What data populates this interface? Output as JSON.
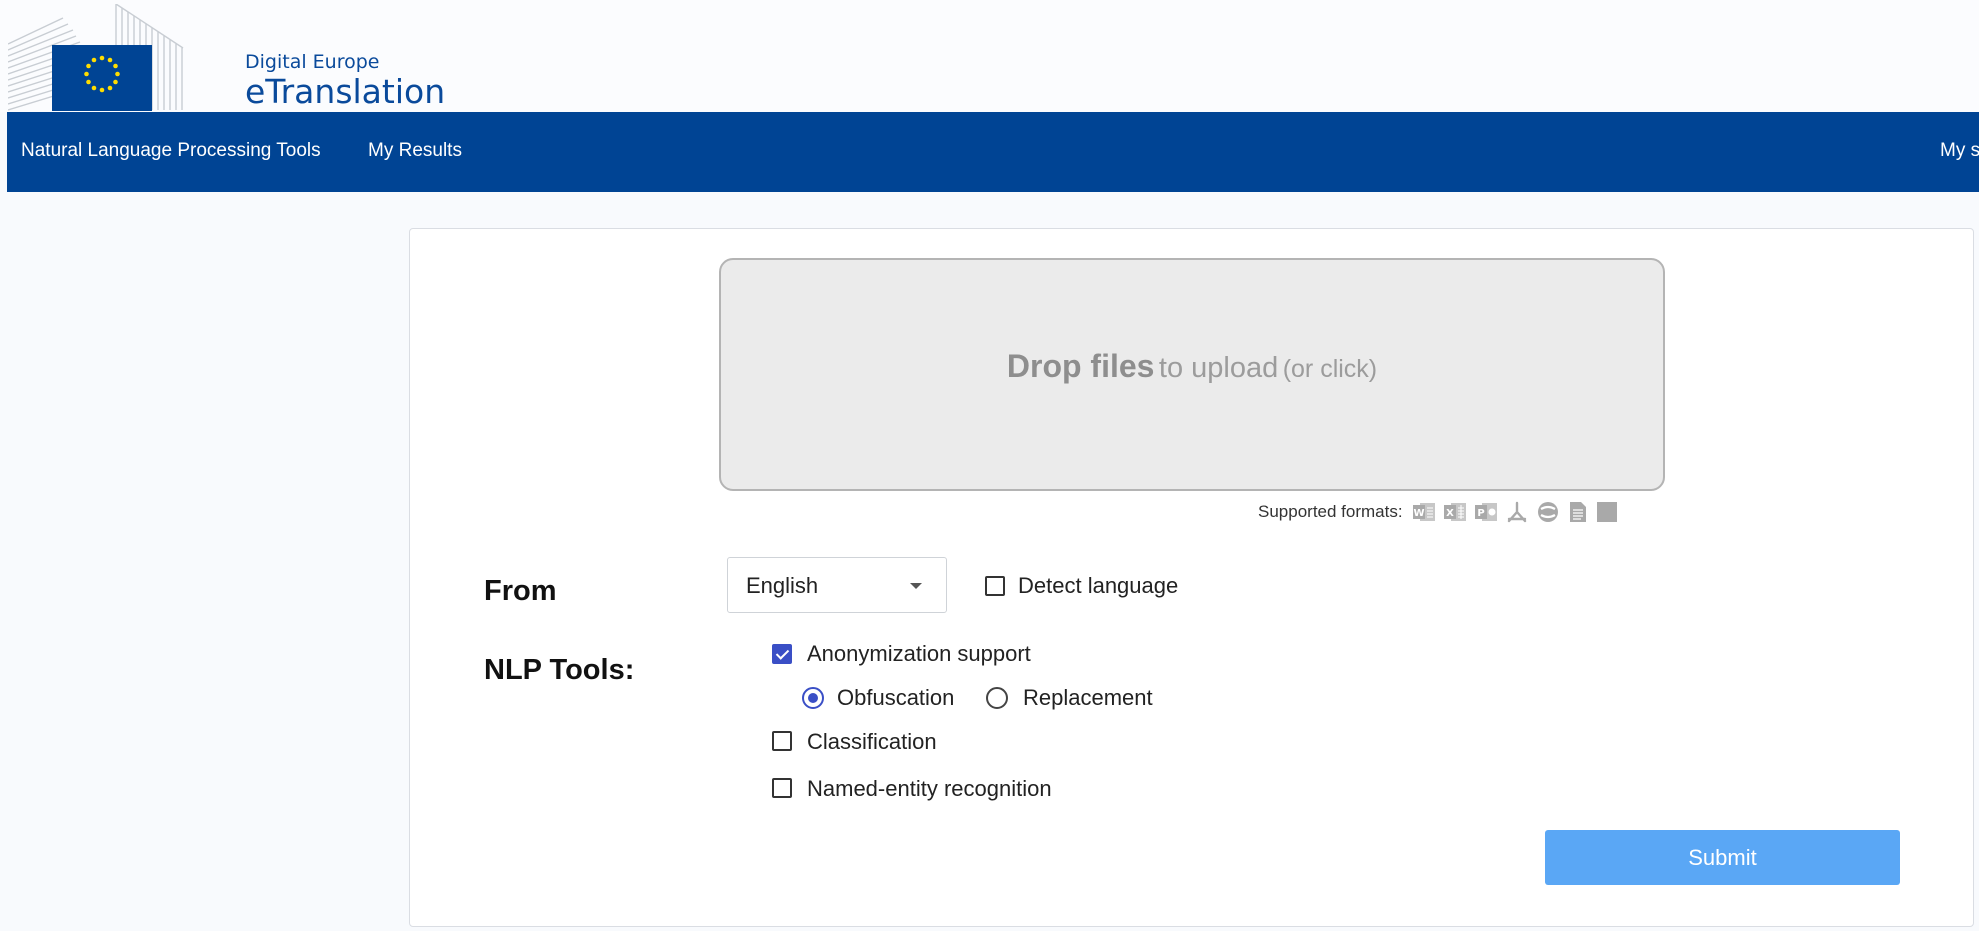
{
  "header": {
    "brand_small": "Digital Europe",
    "brand_big": "eTranslation",
    "logo_icon": "european-commission-logo"
  },
  "nav": {
    "items": [
      "Natural Language Processing Tools",
      "My Results"
    ],
    "right_partial": "My s"
  },
  "upload": {
    "strong": "Drop files",
    "mid": "to upload",
    "small": "(or click)",
    "formats_label": "Supported formats:",
    "format_icons": [
      "word-icon",
      "excel-icon",
      "powerpoint-icon",
      "pdf-icon",
      "web-icon",
      "text-file-icon",
      "generic-file-icon"
    ]
  },
  "form": {
    "from_label": "From",
    "language_value": "English",
    "detect_label": "Detect language",
    "detect_checked": false,
    "nlp_label": "NLP Tools:",
    "anonymization_label": "Anonymization support",
    "anonymization_checked": true,
    "obfuscation_label": "Obfuscation",
    "obfuscation_selected": true,
    "replacement_label": "Replacement",
    "replacement_selected": false,
    "classification_label": "Classification",
    "classification_checked": false,
    "ner_label": "Named-entity recognition",
    "ner_checked": false,
    "submit_label": "Submit"
  },
  "colors": {
    "navbar": "#004494",
    "brand": "#0a4a9b",
    "submit": "#5aa7f5",
    "accent": "#3a4fc6"
  }
}
